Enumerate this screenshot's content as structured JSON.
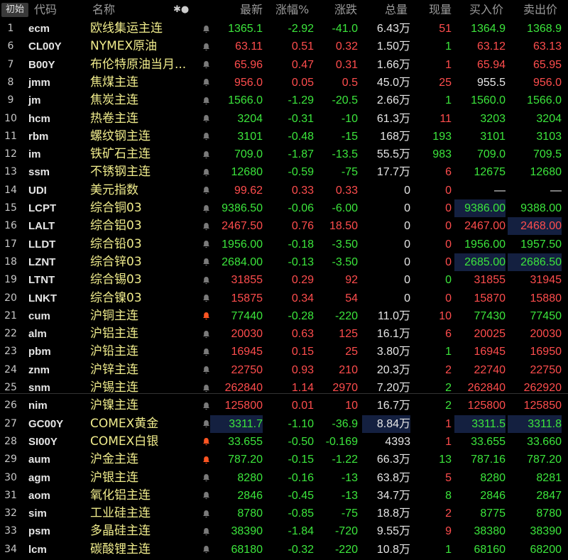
{
  "header": {
    "init": "初始",
    "code": "代码",
    "name": "名称",
    "icons": "✱●",
    "latest": "最新",
    "pct": "涨幅%",
    "chg": "涨跌",
    "vol": "总量",
    "cur": "现量",
    "bid": "买入价",
    "ask": "卖出价"
  },
  "rows": [
    {
      "idx": "1",
      "code": "ecm",
      "name": "欧线集运主连",
      "latest": "1365.1",
      "pct": "-2.92",
      "chg": "-41.0",
      "vol": "6.43万",
      "cur": "51",
      "bid": "1364.9",
      "ask": "1368.9",
      "dir": "dn",
      "cur_dir": "up",
      "bid_dir": "dn",
      "ask_dir": "dn",
      "bell": "normal"
    },
    {
      "idx": "6",
      "code": "CL00Y",
      "name": "NYMEX原油",
      "latest": "63.11",
      "pct": "0.51",
      "chg": "0.32",
      "vol": "1.50万",
      "cur": "1",
      "bid": "63.12",
      "ask": "63.13",
      "dir": "up",
      "cur_dir": "dn",
      "bid_dir": "up",
      "ask_dir": "up",
      "bell": "normal"
    },
    {
      "idx": "7",
      "code": "B00Y",
      "name": "布伦特原油当月...",
      "latest": "65.96",
      "pct": "0.47",
      "chg": "0.31",
      "vol": "1.66万",
      "cur": "1",
      "bid": "65.94",
      "ask": "65.95",
      "dir": "up",
      "cur_dir": "up",
      "bid_dir": "up",
      "ask_dir": "up",
      "bell": "normal"
    },
    {
      "idx": "8",
      "code": "jmm",
      "name": "焦煤主连",
      "latest": "956.0",
      "pct": "0.05",
      "chg": "0.5",
      "vol": "45.0万",
      "cur": "25",
      "bid": "955.5",
      "ask": "956.0",
      "dir": "up",
      "cur_dir": "up",
      "bid_dir": "neu",
      "ask_dir": "up",
      "bell": "normal"
    },
    {
      "idx": "9",
      "code": "jm",
      "name": "焦炭主连",
      "latest": "1566.0",
      "pct": "-1.29",
      "chg": "-20.5",
      "vol": "2.66万",
      "cur": "1",
      "bid": "1560.0",
      "ask": "1566.0",
      "dir": "dn",
      "cur_dir": "dn",
      "bid_dir": "dn",
      "ask_dir": "dn",
      "bell": "normal"
    },
    {
      "idx": "10",
      "code": "hcm",
      "name": "热卷主连",
      "latest": "3204",
      "pct": "-0.31",
      "chg": "-10",
      "vol": "61.3万",
      "cur": "11",
      "bid": "3203",
      "ask": "3204",
      "dir": "dn",
      "cur_dir": "up",
      "bid_dir": "dn",
      "ask_dir": "dn",
      "bell": "normal"
    },
    {
      "idx": "11",
      "code": "rbm",
      "name": "螺纹钢主连",
      "latest": "3101",
      "pct": "-0.48",
      "chg": "-15",
      "vol": "168万",
      "cur": "193",
      "bid": "3101",
      "ask": "3103",
      "dir": "dn",
      "cur_dir": "dn",
      "bid_dir": "dn",
      "ask_dir": "dn",
      "bell": "normal"
    },
    {
      "idx": "12",
      "code": "im",
      "name": "铁矿石主连",
      "latest": "709.0",
      "pct": "-1.87",
      "chg": "-13.5",
      "vol": "55.5万",
      "cur": "983",
      "bid": "709.0",
      "ask": "709.5",
      "dir": "dn",
      "cur_dir": "dn",
      "bid_dir": "dn",
      "ask_dir": "dn",
      "bell": "normal"
    },
    {
      "idx": "13",
      "code": "ssm",
      "name": "不锈钢主连",
      "latest": "12680",
      "pct": "-0.59",
      "chg": "-75",
      "vol": "17.7万",
      "cur": "6",
      "bid": "12675",
      "ask": "12680",
      "dir": "dn",
      "cur_dir": "up",
      "bid_dir": "dn",
      "ask_dir": "dn",
      "bell": "normal"
    },
    {
      "idx": "14",
      "code": "UDI",
      "name": "美元指数",
      "latest": "99.62",
      "pct": "0.33",
      "chg": "0.33",
      "vol": "0",
      "cur": "0",
      "bid": "—",
      "ask": "—",
      "dir": "up",
      "cur_dir": "up",
      "bid_dir": "neu",
      "ask_dir": "neu",
      "bell": "normal"
    },
    {
      "idx": "15",
      "code": "LCPT",
      "name": "综合铜03",
      "latest": "9386.50",
      "pct": "-0.06",
      "chg": "-6.00",
      "vol": "0",
      "cur": "0",
      "bid": "9386.00",
      "ask": "9388.00",
      "dir": "dn",
      "cur_dir": "up",
      "bid_dir": "dn",
      "ask_dir": "dn",
      "bell": "normal"
    },
    {
      "idx": "16",
      "code": "LALT",
      "name": "综合铝03",
      "latest": "2467.50",
      "pct": "0.76",
      "chg": "18.50",
      "vol": "0",
      "cur": "0",
      "bid": "2467.00",
      "ask": "2468.00",
      "dir": "up",
      "cur_dir": "up",
      "bid_dir": "up",
      "ask_dir": "up",
      "bell": "normal"
    },
    {
      "idx": "17",
      "code": "LLDT",
      "name": "综合铅03",
      "latest": "1956.00",
      "pct": "-0.18",
      "chg": "-3.50",
      "vol": "0",
      "cur": "0",
      "bid": "1956.00",
      "ask": "1957.50",
      "dir": "dn",
      "cur_dir": "up",
      "bid_dir": "dn",
      "ask_dir": "dn",
      "bell": "normal"
    },
    {
      "idx": "18",
      "code": "LZNT",
      "name": "综合锌03",
      "latest": "2684.00",
      "pct": "-0.13",
      "chg": "-3.50",
      "vol": "0",
      "cur": "0",
      "bid": "2685.00",
      "ask": "2686.50",
      "dir": "dn",
      "cur_dir": "up",
      "bid_dir": "dn",
      "ask_dir": "dn",
      "bell": "normal"
    },
    {
      "idx": "19",
      "code": "LTNT",
      "name": "综合锡03",
      "latest": "31855",
      "pct": "0.29",
      "chg": "92",
      "vol": "0",
      "cur": "0",
      "bid": "31855",
      "ask": "31945",
      "dir": "up",
      "cur_dir": "dn",
      "bid_dir": "up",
      "ask_dir": "up",
      "bell": "normal"
    },
    {
      "idx": "20",
      "code": "LNKT",
      "name": "综合镍03",
      "latest": "15875",
      "pct": "0.34",
      "chg": "54",
      "vol": "0",
      "cur": "0",
      "bid": "15870",
      "ask": "15880",
      "dir": "up",
      "cur_dir": "up",
      "bid_dir": "up",
      "ask_dir": "up",
      "bell": "normal"
    },
    {
      "idx": "21",
      "code": "cum",
      "name": "沪铜主连",
      "latest": "77440",
      "pct": "-0.28",
      "chg": "-220",
      "vol": "11.0万",
      "cur": "10",
      "bid": "77430",
      "ask": "77450",
      "dir": "dn",
      "cur_dir": "up",
      "bid_dir": "dn",
      "ask_dir": "dn",
      "bell": "alert"
    },
    {
      "idx": "22",
      "code": "alm",
      "name": "沪铝主连",
      "latest": "20030",
      "pct": "0.63",
      "chg": "125",
      "vol": "16.1万",
      "cur": "6",
      "bid": "20025",
      "ask": "20030",
      "dir": "up",
      "cur_dir": "up",
      "bid_dir": "up",
      "ask_dir": "up",
      "bell": "normal"
    },
    {
      "idx": "23",
      "code": "pbm",
      "name": "沪铅主连",
      "latest": "16945",
      "pct": "0.15",
      "chg": "25",
      "vol": "3.80万",
      "cur": "1",
      "bid": "16945",
      "ask": "16950",
      "dir": "up",
      "cur_dir": "dn",
      "bid_dir": "up",
      "ask_dir": "up",
      "bell": "normal"
    },
    {
      "idx": "24",
      "code": "znm",
      "name": "沪锌主连",
      "latest": "22750",
      "pct": "0.93",
      "chg": "210",
      "vol": "20.3万",
      "cur": "2",
      "bid": "22740",
      "ask": "22750",
      "dir": "up",
      "cur_dir": "up",
      "bid_dir": "up",
      "ask_dir": "up",
      "bell": "normal"
    },
    {
      "idx": "25",
      "code": "snm",
      "name": "沪锡主连",
      "latest": "262840",
      "pct": "1.14",
      "chg": "2970",
      "vol": "7.20万",
      "cur": "2",
      "bid": "262840",
      "ask": "262920",
      "dir": "up",
      "cur_dir": "dn",
      "bid_dir": "up",
      "ask_dir": "up",
      "bell": "normal"
    },
    {
      "idx": "26",
      "code": "nim",
      "name": "沪镍主连",
      "latest": "125800",
      "pct": "0.01",
      "chg": "10",
      "vol": "16.7万",
      "cur": "2",
      "bid": "125800",
      "ask": "125850",
      "dir": "up",
      "cur_dir": "dn",
      "bid_dir": "up",
      "ask_dir": "up",
      "bell": "normal"
    },
    {
      "idx": "27",
      "code": "GC00Y",
      "name": "COMEX黄金",
      "latest": "3311.7",
      "pct": "-1.10",
      "chg": "-36.9",
      "vol": "8.84万",
      "cur": "1",
      "bid": "3311.5",
      "ask": "3311.8",
      "dir": "dn",
      "cur_dir": "up",
      "bid_dir": "dn",
      "ask_dir": "dn",
      "bell": "normal"
    },
    {
      "idx": "28",
      "code": "SI00Y",
      "name": "COMEX白银",
      "latest": "33.655",
      "pct": "-0.50",
      "chg": "-0.169",
      "vol": "4393",
      "cur": "1",
      "bid": "33.655",
      "ask": "33.660",
      "dir": "dn",
      "cur_dir": "up",
      "bid_dir": "dn",
      "ask_dir": "dn",
      "bell": "alert"
    },
    {
      "idx": "29",
      "code": "aum",
      "name": "沪金主连",
      "latest": "787.20",
      "pct": "-0.15",
      "chg": "-1.22",
      "vol": "66.3万",
      "cur": "13",
      "bid": "787.16",
      "ask": "787.20",
      "dir": "dn",
      "cur_dir": "dn",
      "bid_dir": "dn",
      "ask_dir": "dn",
      "bell": "alert"
    },
    {
      "idx": "30",
      "code": "agm",
      "name": "沪银主连",
      "latest": "8280",
      "pct": "-0.16",
      "chg": "-13",
      "vol": "63.8万",
      "cur": "5",
      "bid": "8280",
      "ask": "8281",
      "dir": "dn",
      "cur_dir": "up",
      "bid_dir": "dn",
      "ask_dir": "dn",
      "bell": "normal"
    },
    {
      "idx": "31",
      "code": "aom",
      "name": "氧化铝主连",
      "latest": "2846",
      "pct": "-0.45",
      "chg": "-13",
      "vol": "34.7万",
      "cur": "8",
      "bid": "2846",
      "ask": "2847",
      "dir": "dn",
      "cur_dir": "dn",
      "bid_dir": "dn",
      "ask_dir": "dn",
      "bell": "normal"
    },
    {
      "idx": "32",
      "code": "sim",
      "name": "工业硅主连",
      "latest": "8780",
      "pct": "-0.85",
      "chg": "-75",
      "vol": "18.8万",
      "cur": "2",
      "bid": "8775",
      "ask": "8780",
      "dir": "dn",
      "cur_dir": "up",
      "bid_dir": "dn",
      "ask_dir": "dn",
      "bell": "normal"
    },
    {
      "idx": "33",
      "code": "psm",
      "name": "多晶硅主连",
      "latest": "38390",
      "pct": "-1.84",
      "chg": "-720",
      "vol": "9.55万",
      "cur": "9",
      "bid": "38380",
      "ask": "38390",
      "dir": "dn",
      "cur_dir": "up",
      "bid_dir": "dn",
      "ask_dir": "dn",
      "bell": "normal"
    },
    {
      "idx": "34",
      "code": "lcm",
      "name": "碳酸锂主连",
      "latest": "68180",
      "pct": "-0.32",
      "chg": "-220",
      "vol": "10.8万",
      "cur": "1",
      "bid": "68160",
      "ask": "68200",
      "dir": "dn",
      "cur_dir": "dn",
      "bid_dir": "dn",
      "ask_dir": "dn",
      "bell": "normal"
    }
  ],
  "colors": {
    "up": "#ff4d4d",
    "down": "#3ce63c",
    "name": "#f0ec8c",
    "alert_bell": "#ff5522"
  },
  "icons": {
    "bell": "bell-icon"
  }
}
